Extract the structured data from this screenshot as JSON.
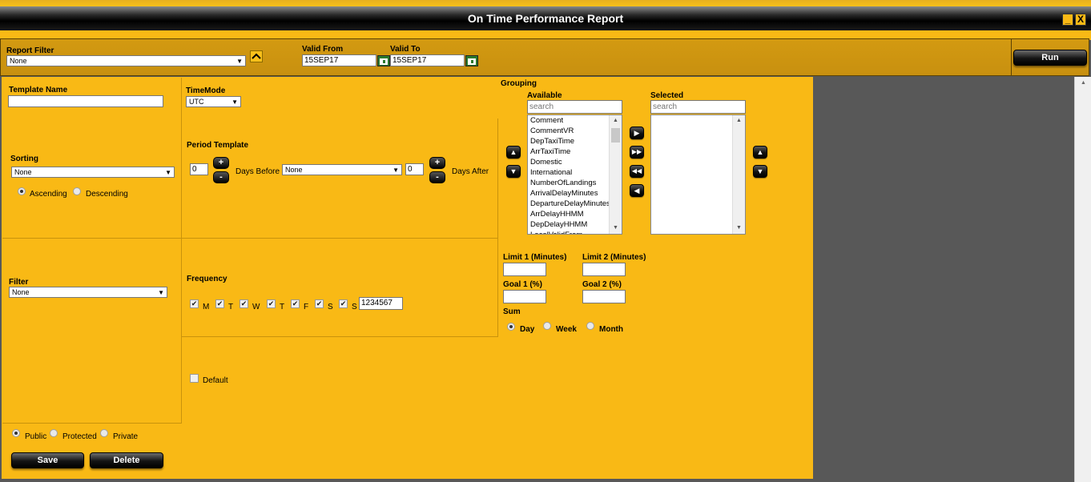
{
  "window": {
    "title": "On Time Performance Report",
    "minimize_glyph": "_",
    "close_glyph": "X"
  },
  "toolbar": {
    "report_filter_label": "Report Filter",
    "report_filter_value": "None",
    "valid_from_label": "Valid From",
    "valid_from_value": "15SEP17",
    "valid_to_label": "Valid To",
    "valid_to_value": "15SEP17",
    "run_label": "Run"
  },
  "template": {
    "name_label": "Template Name",
    "name_value": "",
    "timemode_label": "TimeMode",
    "timemode_value": "UTC"
  },
  "sorting": {
    "label": "Sorting",
    "value": "None",
    "ascending_label": "Ascending",
    "descending_label": "Descending",
    "selected": "ascending"
  },
  "period": {
    "label": "Period Template",
    "before_value": "0",
    "days_before_label": "Days Before",
    "template_value": "None",
    "after_value": "0",
    "days_after_label": "Days After",
    "plus": "+",
    "minus": "-"
  },
  "grouping": {
    "label": "Grouping",
    "available_label": "Available",
    "selected_label": "Selected",
    "available_search_placeholder": "search",
    "selected_search_placeholder": "search",
    "available_items": [
      "Comment",
      "CommentVR",
      "DepTaxiTime",
      "ArrTaxiTime",
      "Domestic",
      "International",
      "NumberOfLandings",
      "ArrivalDelayMinutes",
      "DepartureDelayMinutes",
      "ArrDelayHHMM",
      "DepDelayHHMM",
      "LocalValidFrom"
    ],
    "selected_items": []
  },
  "filter": {
    "label": "Filter",
    "value": "None"
  },
  "frequency": {
    "label": "Frequency",
    "days": [
      "M",
      "T",
      "W",
      "T",
      "F",
      "S",
      "S"
    ],
    "value": "1234567"
  },
  "limits": {
    "limit1_label": "Limit 1 (Minutes)",
    "limit2_label": "Limit 2 (Minutes)",
    "goal1_label": "Goal 1 (%)",
    "goal2_label": "Goal 2 (%)",
    "sum_label": "Sum",
    "day_label": "Day",
    "week_label": "Week",
    "month_label": "Month",
    "selected": "day"
  },
  "default_label": "Default",
  "visibility": {
    "public_label": "Public",
    "protected_label": "Protected",
    "private_label": "Private",
    "selected": "public"
  },
  "actions": {
    "save_label": "Save",
    "delete_label": "Delete"
  },
  "colors": {
    "panel": "#f9b915",
    "toolbar": "#d39a11",
    "background": "#585858"
  }
}
